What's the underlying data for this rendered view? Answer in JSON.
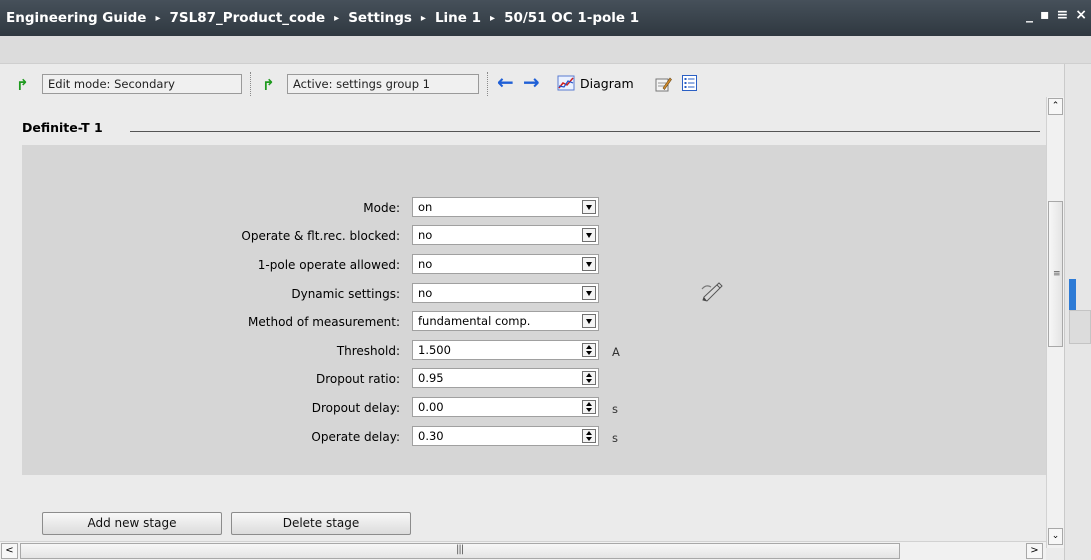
{
  "titlebar": {
    "breadcrumb": [
      "Engineering Guide",
      "7SL87_Product_code",
      "Settings",
      "Line 1",
      "50/51 OC 1-pole 1"
    ],
    "separator": "▸",
    "window_controls": [
      "_",
      "▪",
      "≡",
      "×"
    ]
  },
  "toolbar": {
    "edit_mode_value": "Edit mode:  Secondary",
    "active_group_value": "Active:  settings group 1",
    "back_icon": "arrow-left-icon",
    "forward_icon": "arrow-right-icon",
    "diagram_label": "Diagram"
  },
  "section": {
    "title": "Definite-T 1"
  },
  "parameters": [
    {
      "label": "Mode:",
      "value": "on",
      "control": "dropdown",
      "unit": ""
    },
    {
      "label": "Operate & flt.rec. blocked:",
      "value": "no",
      "control": "dropdown",
      "unit": ""
    },
    {
      "label": "1-pole operate allowed:",
      "value": "no",
      "control": "dropdown",
      "unit": ""
    },
    {
      "label": "Dynamic settings:",
      "value": "no",
      "control": "dropdown",
      "unit": ""
    },
    {
      "label": "Method of measurement:",
      "value": "fundamental comp.",
      "control": "dropdown",
      "unit": ""
    },
    {
      "label": "Threshold:",
      "value": "1.500",
      "control": "spinner",
      "unit": "A"
    },
    {
      "label": "Dropout ratio:",
      "value": "0.95",
      "control": "spinner",
      "unit": ""
    },
    {
      "label": "Dropout delay:",
      "value": "0.00",
      "control": "spinner",
      "unit": "s"
    },
    {
      "label": "Operate delay:",
      "value": "0.30",
      "control": "spinner",
      "unit": "s"
    }
  ],
  "buttons": {
    "add_stage": "Add new stage",
    "delete_stage": "Delete stage"
  },
  "scrollbar": {
    "up": "⌃",
    "down": "⌄",
    "left": "<",
    "right": ">",
    "grip_v": "≡",
    "grip_h": "|||"
  },
  "colors": {
    "titlebar": "#3a444e",
    "panel": "#d6d6d6",
    "accent_blue": "#1f5fd6",
    "accent_green": "#1e9a1e"
  }
}
